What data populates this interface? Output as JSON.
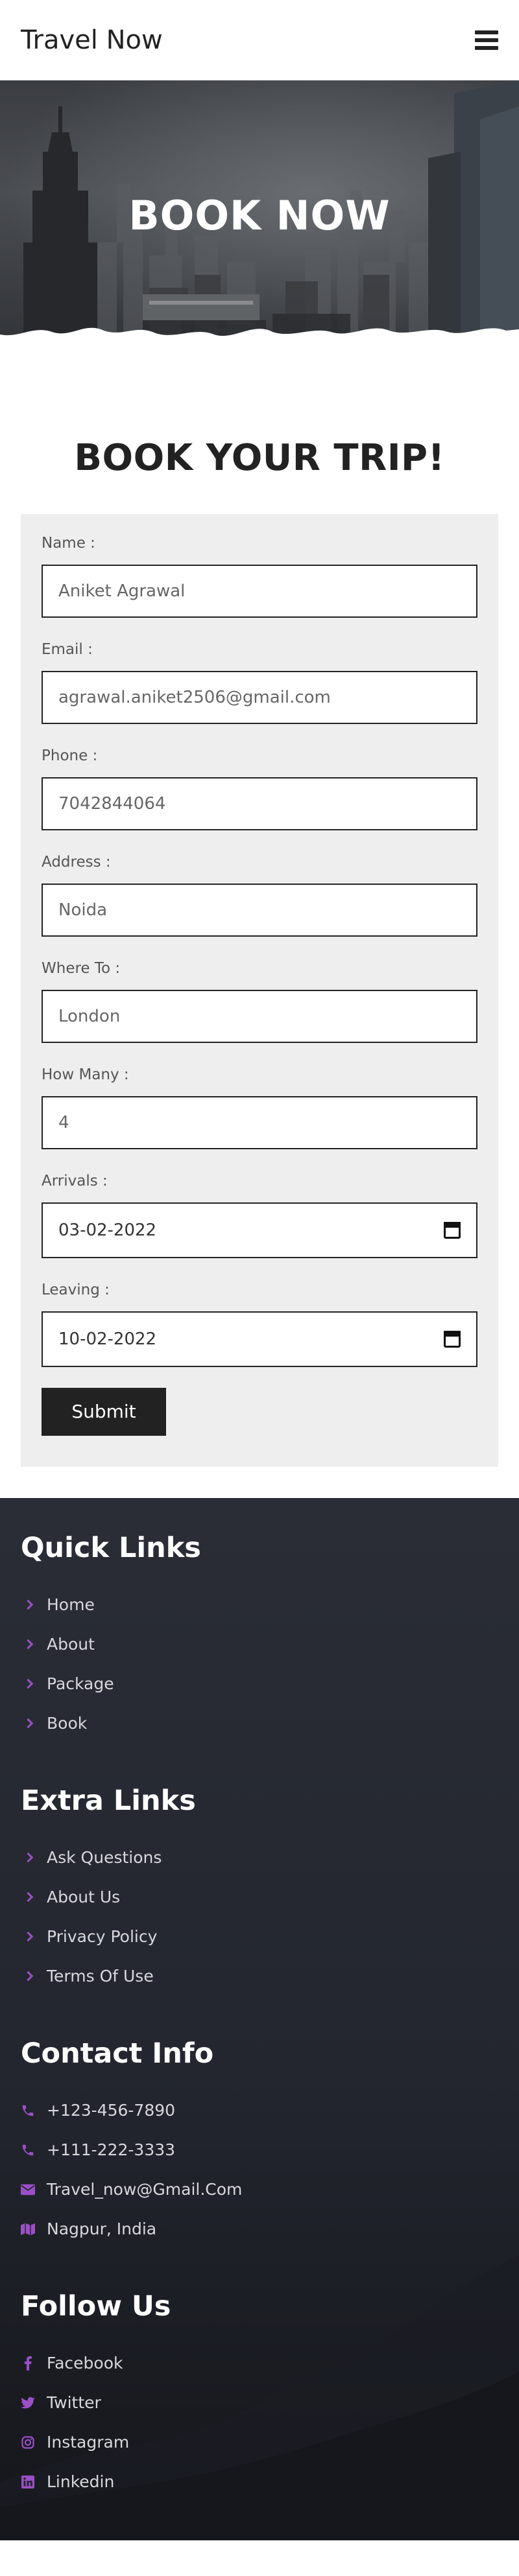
{
  "header": {
    "logo": "Travel Now",
    "menu_icon": "hamburger-icon"
  },
  "hero": {
    "title": "BOOK NOW"
  },
  "booking": {
    "heading": "BOOK YOUR TRIP!",
    "fields": [
      {
        "label": "Name :",
        "value": "Aniket Agrawal"
      },
      {
        "label": "Email :",
        "value": "agrawal.aniket2506@gmail.com"
      },
      {
        "label": "Phone :",
        "value": "7042844064"
      },
      {
        "label": "Address :",
        "value": "Noida"
      },
      {
        "label": "Where To :",
        "value": "London"
      },
      {
        "label": "How Many :",
        "value": "4"
      },
      {
        "label": "Arrivals :",
        "value": "03-02-2022"
      },
      {
        "label": "Leaving :",
        "value": "10-02-2022"
      }
    ],
    "submit_label": "Submit"
  },
  "footer": {
    "quick_links": {
      "title": "Quick Links",
      "items": [
        "Home",
        "About",
        "Package",
        "Book"
      ]
    },
    "extra_links": {
      "title": "Extra Links",
      "items": [
        "Ask Questions",
        "About Us",
        "Privacy Policy",
        "Terms Of Use"
      ]
    },
    "contact": {
      "title": "Contact Info",
      "items": [
        {
          "icon": "phone-icon",
          "text": "+123-456-7890"
        },
        {
          "icon": "phone-icon",
          "text": "+111-222-3333"
        },
        {
          "icon": "envelope-icon",
          "text": "Travel_now@Gmail.Com"
        },
        {
          "icon": "map-icon",
          "text": "Nagpur, India"
        }
      ]
    },
    "follow": {
      "title": "Follow Us",
      "items": [
        {
          "icon": "facebook-icon",
          "text": "Facebook"
        },
        {
          "icon": "twitter-icon",
          "text": "Twitter"
        },
        {
          "icon": "instagram-icon",
          "text": "Instagram"
        },
        {
          "icon": "linkedin-icon",
          "text": "Linkedin"
        }
      ]
    },
    "accent_color": "#9b4fc7"
  }
}
